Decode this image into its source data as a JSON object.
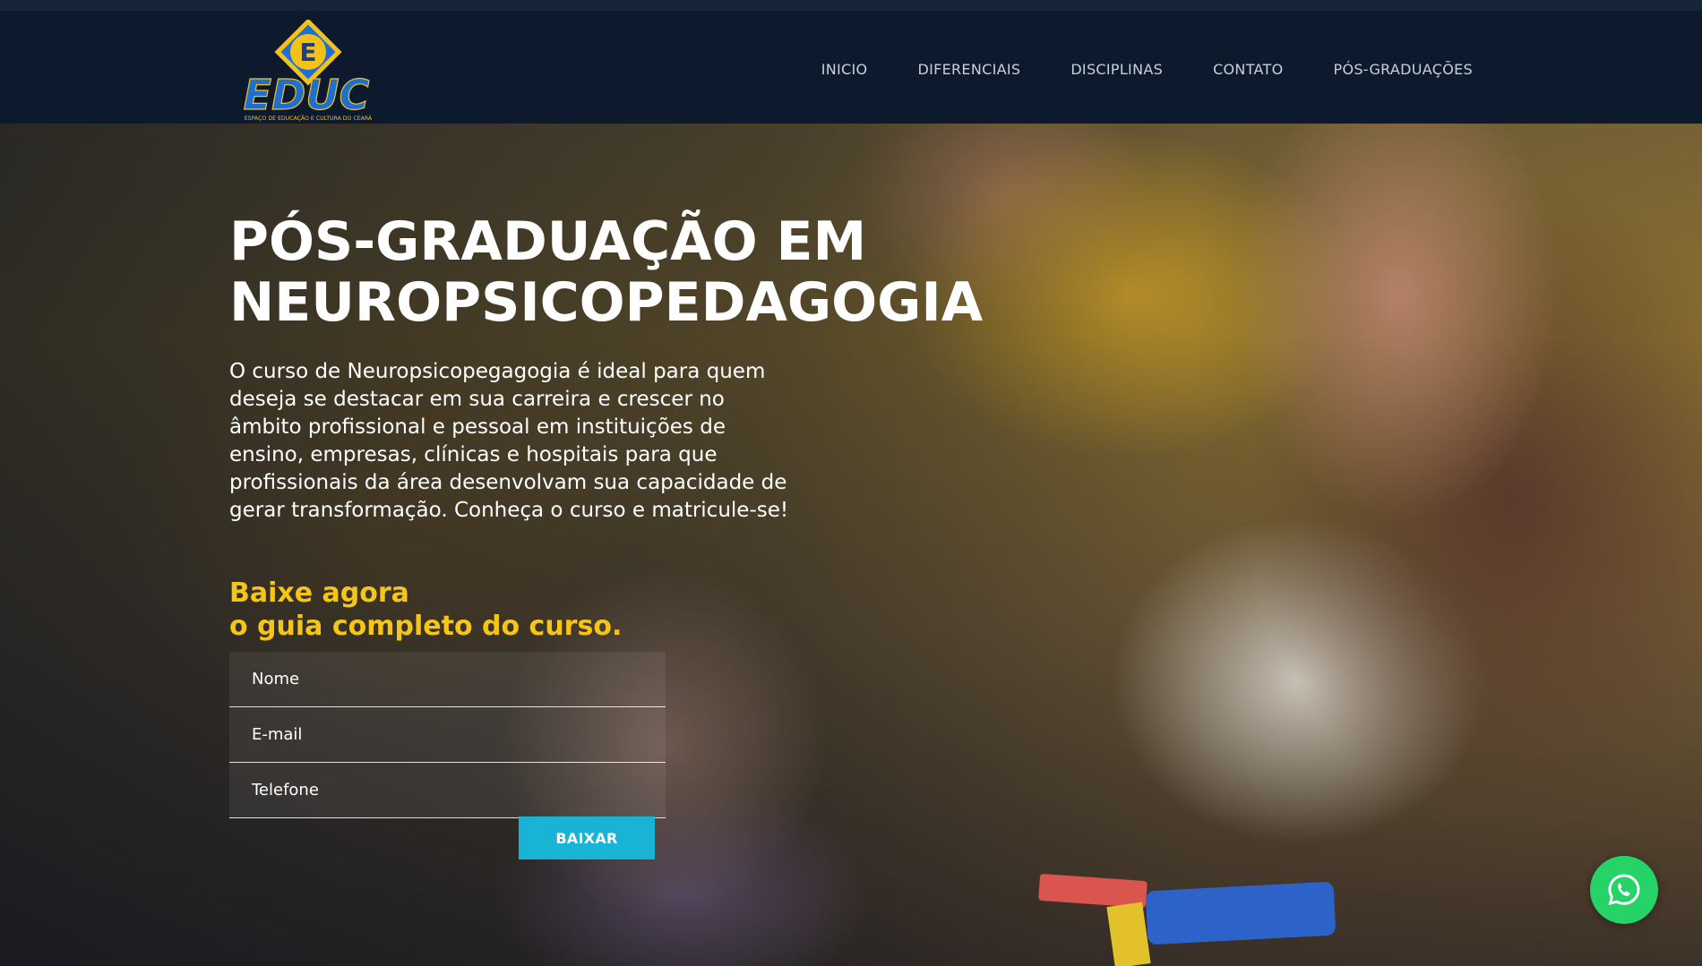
{
  "brand": {
    "name": "EDUC",
    "tagline": "ESPAÇO DE EDUCAÇÃO E CULTURA DO CEARÁ",
    "initial": "E"
  },
  "nav": {
    "items": [
      {
        "label": "INICIO"
      },
      {
        "label": "DIFERENCIAIS"
      },
      {
        "label": "DISCIPLINAS"
      },
      {
        "label": "CONTATO"
      },
      {
        "label": "PÓS-GRADUAÇÕES"
      }
    ]
  },
  "hero": {
    "title_line1": "PÓS-GRADUAÇÃO EM",
    "title_line2": "NEUROPSICOPEDAGOGIA",
    "description": "O curso de Neuropsicopegagogia é ideal para quem deseja se destacar em sua carreira e crescer no âmbito profissional e pessoal em instituições de ensino, empresas, clínicas e hospitais para que profissionais da área desenvolvam sua capacidade de gerar transformação. Conheça o curso e matricule-se!"
  },
  "lead_form": {
    "heading_line1": "Baixe agora",
    "heading_line2": "o guia completo do curso.",
    "name_placeholder": "Nome",
    "email_placeholder": "E-mail",
    "phone_placeholder": "Telefone",
    "submit_label": "BAIXAR"
  },
  "colors": {
    "header_bg": "#0d1a2d",
    "accent_yellow": "#f5c518",
    "button_cyan": "#19b3d6",
    "whatsapp_green": "#25d366",
    "logo_blue": "#1f6fd1",
    "logo_yellow": "#f2c21b"
  },
  "icons": {
    "floating_chat": "whatsapp-icon"
  }
}
